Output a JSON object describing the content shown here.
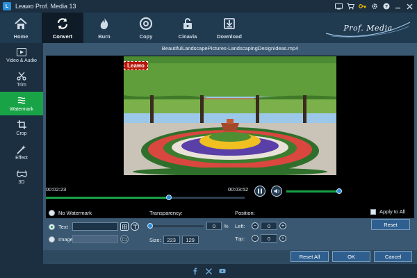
{
  "window": {
    "title": "Leawo Prof. Media 13",
    "controls": [
      "screen-icon",
      "cart-icon",
      "key-icon",
      "gear-icon",
      "help-icon",
      "minimize-icon",
      "close-icon"
    ]
  },
  "toolbar": {
    "tools": [
      {
        "label": "Home",
        "icon": "home-icon"
      },
      {
        "label": "Convert",
        "icon": "convert-icon",
        "active": true
      },
      {
        "label": "Burn",
        "icon": "burn-icon"
      },
      {
        "label": "Copy",
        "icon": "copy-icon"
      },
      {
        "label": "Cinavia",
        "icon": "cinavia-icon"
      },
      {
        "label": "Download",
        "icon": "download-icon"
      }
    ],
    "brand": "Prof. Media"
  },
  "sidebar": {
    "items": [
      {
        "label": "Video & Audio",
        "icon": "film-icon"
      },
      {
        "label": "Trim",
        "icon": "scissors-icon"
      },
      {
        "label": "Watermark",
        "icon": "watermark-icon",
        "active": true
      },
      {
        "label": "Crop",
        "icon": "crop-icon"
      },
      {
        "label": "Effect",
        "icon": "effect-icon"
      },
      {
        "label": "3D",
        "icon": "glasses-3d-icon"
      }
    ]
  },
  "player": {
    "file_name": "BeautifulLandscapePictures-LandscapingDesignIdeas.mp4",
    "watermark_text": "Leawo",
    "current_time": "00:02:23",
    "total_time": "00:03:52",
    "progress": 0.62,
    "volume": 1.0
  },
  "watermark": {
    "no_watermark_label": "No Watermark",
    "text_label": "Text",
    "image_label": "Image",
    "selected": "text",
    "transparency_label": "Transparency:",
    "transparency_value": "0",
    "transparency_unit": "%",
    "size_label": "Size:",
    "size_width": "223",
    "size_height": "129",
    "position_label": "Position:",
    "left_label": "Left:",
    "left_value": "0",
    "top_label": "Top:",
    "top_value": "0",
    "apply_all_label": "Apply to All",
    "reset_label": "Reset"
  },
  "actions": {
    "reset_all": "Reset All",
    "ok": "OK",
    "cancel": "Cancel"
  },
  "colors": {
    "accent_green": "#19a347",
    "accent_blue": "#2a8fd8",
    "panel": "#3a5871",
    "dark": "#1b2f40"
  }
}
